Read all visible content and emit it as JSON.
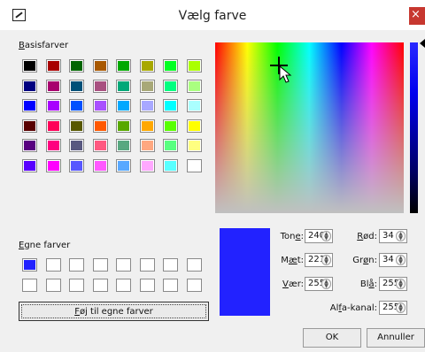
{
  "dialog": {
    "title": "Vælg farve",
    "close": "×"
  },
  "basic": {
    "label_prefix": "B",
    "label_rest": "asisfarver",
    "swatches": [
      "#000000",
      "#a80000",
      "#006400",
      "#a85800",
      "#00a800",
      "#a8a800",
      "#00ff22",
      "#aaff00",
      "#000080",
      "#a8006e",
      "#005078",
      "#a85080",
      "#00a878",
      "#a8a878",
      "#00ff80",
      "#aaff80",
      "#0000ff",
      "#a800ff",
      "#0050ff",
      "#a850ff",
      "#00a8ff",
      "#a8a8ff",
      "#00ffff",
      "#aaffff",
      "#580000",
      "#ff0058",
      "#585800",
      "#ff5800",
      "#58a800",
      "#ffa800",
      "#58ff00",
      "#ffff00",
      "#580080",
      "#ff0080",
      "#585880",
      "#ff5880",
      "#58a880",
      "#ffa880",
      "#58ff80",
      "#ffff80",
      "#5800ff",
      "#ff00ff",
      "#5858ff",
      "#ff58ff",
      "#58a8ff",
      "#ffa8ff",
      "#58ffff",
      "#ffffff"
    ]
  },
  "custom": {
    "label_prefix": "E",
    "label_rest": "gne farver",
    "swatches": [
      "#2222ff",
      "#ffffff",
      "#ffffff",
      "#ffffff",
      "#ffffff",
      "#ffffff",
      "#ffffff",
      "#ffffff",
      "#ffffff",
      "#ffffff",
      "#ffffff",
      "#ffffff",
      "#ffffff",
      "#ffffff",
      "#ffffff",
      "#ffffff"
    ],
    "add_button_prefix": "F",
    "add_button_rest": "øj til egne farver"
  },
  "selected_color": "#2222ff",
  "fields": {
    "hue": {
      "label_a": "Ton",
      "label_u": "e",
      "label_b": ":",
      "value": "240"
    },
    "sat": {
      "label_a": "M",
      "label_u": "æ",
      "label_b": "t:",
      "value": "221"
    },
    "lum": {
      "label_a": "",
      "label_u": "V",
      "label_b": "ær:",
      "value": "255"
    },
    "red": {
      "label_a": "",
      "label_u": "R",
      "label_b": "ød:",
      "value": "34"
    },
    "green": {
      "label_a": "Gr",
      "label_u": "ø",
      "label_b": "n:",
      "value": "34"
    },
    "blue": {
      "label_a": "Bl",
      "label_u": "å",
      "label_b": ":",
      "value": "255"
    },
    "alpha": {
      "label_a": "Al",
      "label_u": "f",
      "label_b": "a-kanal:",
      "value": "255"
    }
  },
  "buttons": {
    "ok": "OK",
    "cancel": "Annuller"
  },
  "icons": {
    "app": "color-dialog-icon",
    "close": "close-icon",
    "spin": "spin-arrows-icon",
    "cursor": "mouse-pointer-icon"
  }
}
